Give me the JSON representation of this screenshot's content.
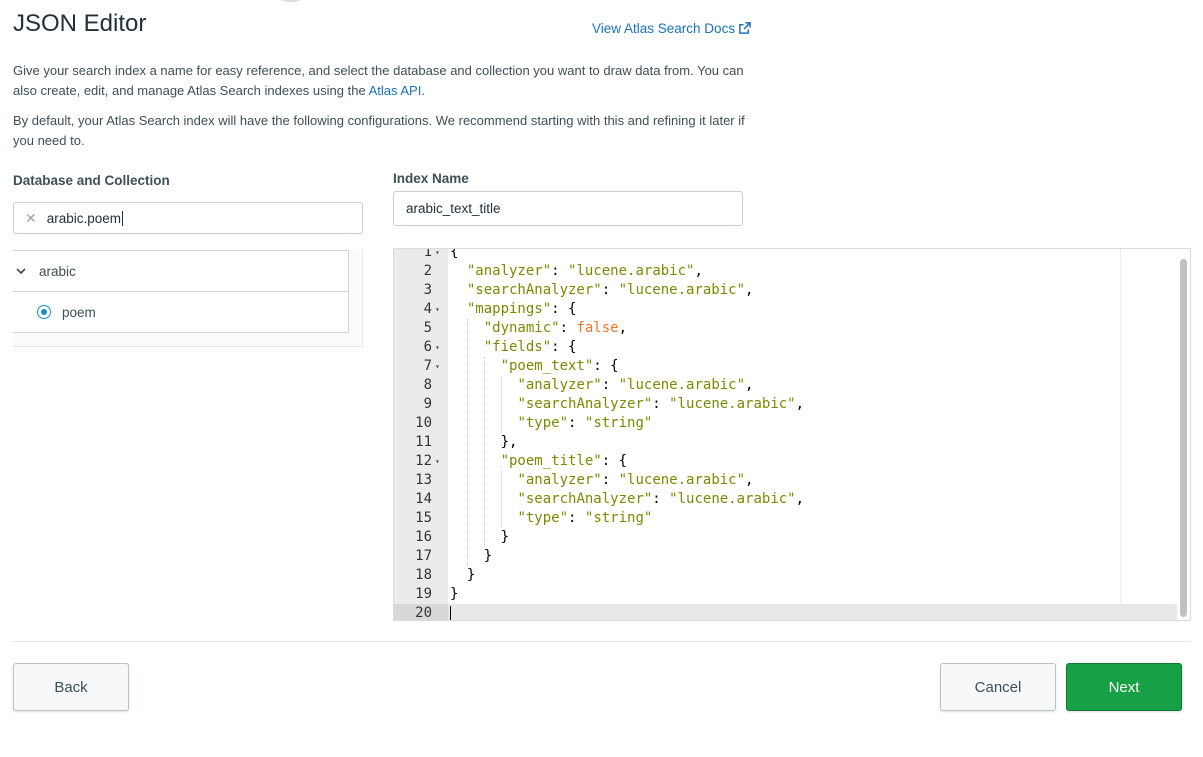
{
  "header": {
    "title": "JSON Editor",
    "docs_link_label": "View Atlas Search Docs"
  },
  "intro": {
    "para1_text": "Give your search index a name for easy reference, and select the database and collection you want to draw data from. You can also create, edit, and manage Atlas Search indexes using the ",
    "para1_link": "Atlas API",
    "para1_end": ".",
    "para2_text": "By default, your Atlas Search index will have the following configurations. We recommend starting with this and refining it later if you need to."
  },
  "database_collection": {
    "label": "Database and Collection",
    "search_value": "arabic.poem",
    "database": "arabic",
    "collection": "poem"
  },
  "index_name": {
    "label": "Index Name",
    "value": "arabic_text_title"
  },
  "editor": {
    "line_numbers": [
      "1",
      "2",
      "3",
      "4",
      "5",
      "6",
      "7",
      "8",
      "9",
      "10",
      "11",
      "12",
      "13",
      "14",
      "15",
      "16",
      "17",
      "18",
      "19",
      "20"
    ],
    "folds": [
      "1",
      "4",
      "6",
      "7",
      "12"
    ],
    "lines": [
      "{",
      "  \"analyzer\": \"lucene.arabic\",",
      "  \"searchAnalyzer\": \"lucene.arabic\",",
      "  \"mappings\": {",
      "    \"dynamic\": false,",
      "    \"fields\": {",
      "      \"poem_text\": {",
      "        \"analyzer\": \"lucene.arabic\",",
      "        \"searchAnalyzer\": \"lucene.arabic\",",
      "        \"type\": \"string\"",
      "      },",
      "      \"poem_title\": {",
      "        \"analyzer\": \"lucene.arabic\",",
      "        \"searchAnalyzer\": \"lucene.arabic\",",
      "        \"type\": \"string\"",
      "      }",
      "    }",
      "  }",
      "}",
      ""
    ],
    "active_line": 20
  },
  "footer": {
    "back_label": "Back",
    "cancel_label": "Cancel",
    "next_label": "Next"
  },
  "colors": {
    "primary_green": "#17a046",
    "link_blue": "#1a73b8",
    "json_string": "#7a8a00",
    "json_boolean": "#e8792d"
  }
}
